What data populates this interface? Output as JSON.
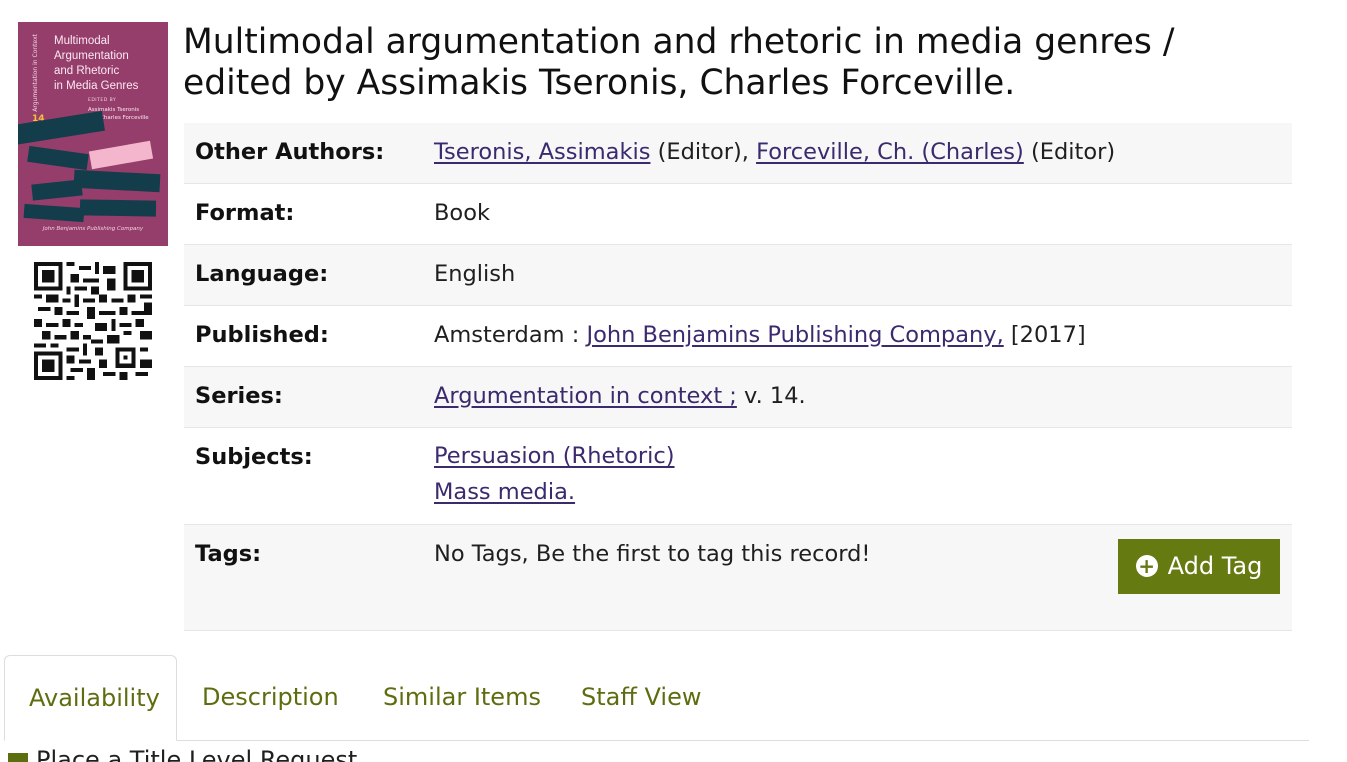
{
  "cover": {
    "title_lines": [
      "Multimodal",
      "Argumentation",
      "and Rhetoric",
      "in Media Genres"
    ],
    "spine_text": "Argumentation in Context",
    "edited_by": "EDITED BY",
    "editors_lines": [
      "Assimakis Tseronis",
      "and Charles Forceville"
    ],
    "number": "14",
    "publisher": "John Benjamins Publishing Company",
    "colors": {
      "background": "#963e6b",
      "bars": "#143d4c",
      "accent": "#f3b6cd"
    }
  },
  "record": {
    "title_line1": "Multimodal argumentation and rhetoric in media genres /",
    "title_line2": "edited by Assimakis Tseronis, Charles Forceville."
  },
  "details": {
    "other_authors": {
      "label": "Other Authors:",
      "author1": "Tseronis, Assimakis",
      "role1": " (Editor), ",
      "author2": "Forceville, Ch. (Charles)",
      "role2": " (Editor)"
    },
    "format": {
      "label": "Format:",
      "value": "Book"
    },
    "language": {
      "label": "Language:",
      "value": "English"
    },
    "published": {
      "label": "Published:",
      "place": "Amsterdam : ",
      "publisher": "John Benjamins Publishing Company,",
      "year": " [2017]"
    },
    "series": {
      "label": "Series:",
      "link": "Argumentation in context ;",
      "suffix": " v. 14."
    },
    "subjects": {
      "label": "Subjects:",
      "items": [
        "Persuasion (Rhetoric)",
        "Mass media."
      ]
    },
    "tags": {
      "label": "Tags:",
      "value": "No Tags, Be the first to tag this record!",
      "button": "Add Tag"
    }
  },
  "tabs": [
    "Availability",
    "Description",
    "Similar Items",
    "Staff View"
  ],
  "below_text": "Place a Title Level Request",
  "colors": {
    "accent": "#667a12",
    "link": "#3b2a6e",
    "tab_text": "#5c6f10"
  }
}
